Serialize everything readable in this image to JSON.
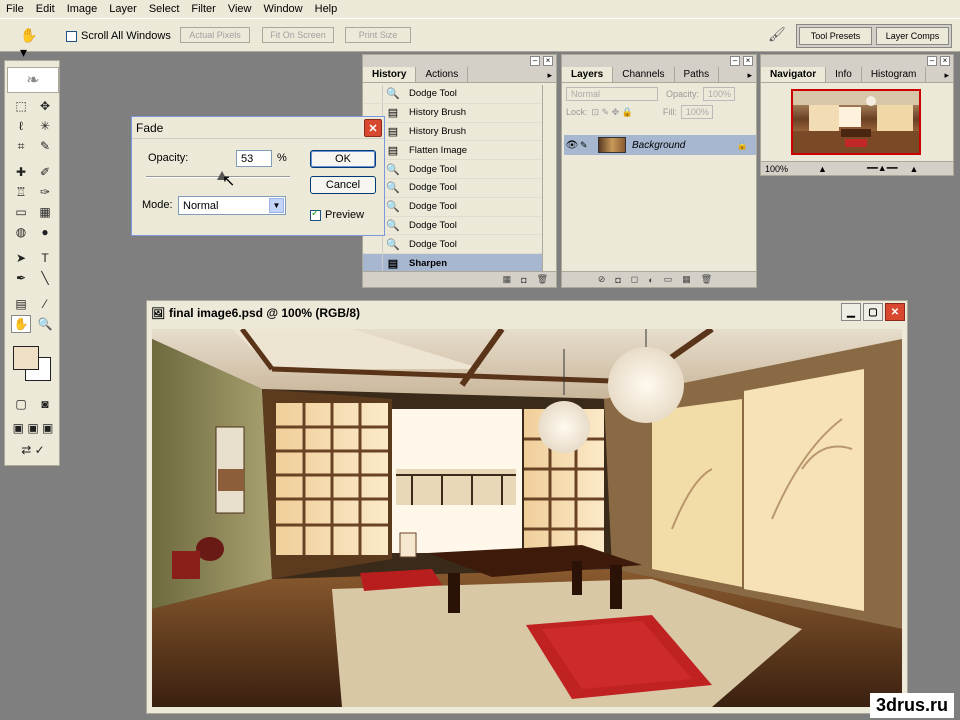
{
  "menu": [
    "File",
    "Edit",
    "Image",
    "Layer",
    "Select",
    "Filter",
    "View",
    "Window",
    "Help"
  ],
  "options": {
    "scroll_all": "Scroll All Windows",
    "actual_pixels": "Actual Pixels",
    "fit_on_screen": "Fit On Screen",
    "print_size": "Print Size",
    "tool_presets": "Tool Presets",
    "layer_comps": "Layer Comps"
  },
  "history": {
    "tabs": [
      "History",
      "Actions"
    ],
    "items": [
      "Dodge Tool",
      "History Brush",
      "History Brush",
      "Flatten Image",
      "Dodge Tool",
      "Dodge Tool",
      "Dodge Tool",
      "Dodge Tool",
      "Dodge Tool",
      "Sharpen"
    ]
  },
  "layers": {
    "tabs": [
      "Layers",
      "Channels",
      "Paths"
    ],
    "blend_mode": "Normal",
    "opacity_label": "Opacity:",
    "opacity_value": "100%",
    "lock_label": "Lock:",
    "fill_label": "Fill:",
    "fill_value": "100%",
    "layer_name": "Background"
  },
  "navigator": {
    "tabs": [
      "Navigator",
      "Info",
      "Histogram"
    ],
    "zoom": "100%"
  },
  "fade": {
    "title": "Fade",
    "opacity_label": "Opacity:",
    "opacity_value": "53",
    "opacity_unit": "%",
    "opacity_fraction": 0.53,
    "mode_label": "Mode:",
    "mode_value": "Normal",
    "ok": "OK",
    "cancel": "Cancel",
    "preview": "Preview",
    "preview_checked": true
  },
  "document": {
    "title": "final image6.psd @ 100% (RGB/8)"
  },
  "watermark": "3drus.ru"
}
